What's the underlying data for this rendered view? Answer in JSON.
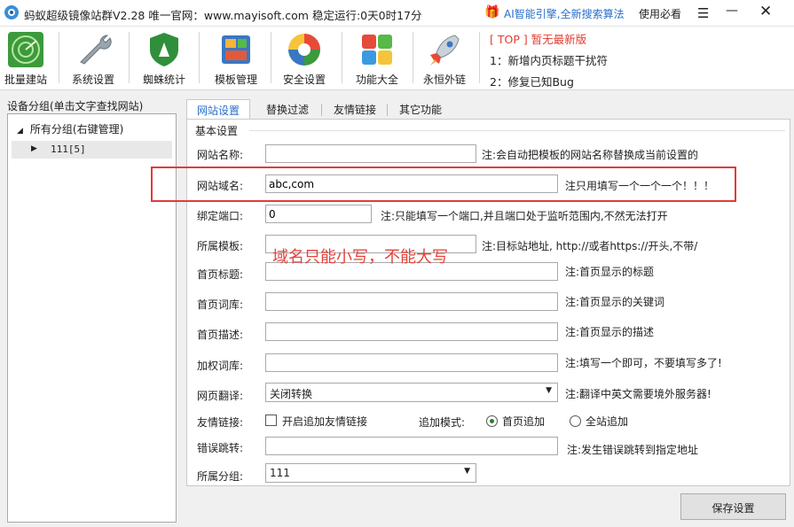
{
  "window": {
    "title": "蚂蚁超级镜像站群V2.28  唯一官网：www.mayisoft.com  稳定运行:0天0时17分",
    "ai_link": "AI智能引擎,全新搜索算法",
    "help": "使用必看",
    "minimize": "—",
    "close": "✕"
  },
  "toolbar": {
    "items": [
      {
        "label": "批量建站",
        "icon": "radar-icon"
      },
      {
        "label": "系统设置",
        "icon": "wrench-icon"
      },
      {
        "label": "蜘蛛统计",
        "icon": "spider-shield-icon"
      },
      {
        "label": "模板管理",
        "icon": "template-icon"
      },
      {
        "label": "安全设置",
        "icon": "security-icon"
      },
      {
        "label": "功能大全",
        "icon": "tiles-icon"
      },
      {
        "label": "永恒外链",
        "icon": "rocket-icon"
      }
    ],
    "news_title": "[ TOP ] 暂无最新版",
    "news_lines": [
      "1：新增内页标题干扰符",
      "2：修复已知Bug"
    ]
  },
  "left": {
    "label": "设备分组(单击文字查找网站)",
    "root": "所有分组(右键管理)",
    "child": "111[5]"
  },
  "tabs": [
    "网站设置",
    "替换过滤",
    "友情链接",
    "其它功能"
  ],
  "form": {
    "group": "基本设置",
    "site_name": {
      "label": "网站名称:",
      "value": "",
      "note": "注:会自动把模板的网站名称替换成当前设置的"
    },
    "domain": {
      "label": "网站域名:",
      "value": "abc,com",
      "note": "注只用填写一个一个一个！！！"
    },
    "port": {
      "label": "绑定端口:",
      "value": "0",
      "note": "注:只能填写一个端口,并且端口处于监听范围内,不然无法打开"
    },
    "template": {
      "label": "所属模板:",
      "value": "",
      "note": "注:目标站地址, http://或者https://开头,不带/"
    },
    "home_title": {
      "label": "首页标题:",
      "value": "",
      "note": "注:首页显示的标题"
    },
    "home_keywords": {
      "label": "首页词库:",
      "value": "",
      "note": "注:首页显示的关键词"
    },
    "home_desc": {
      "label": "首页描述:",
      "value": "",
      "note": "注:首页显示的描述"
    },
    "weight_words": {
      "label": "加权词库:",
      "value": "",
      "note": "注:填写一个即可，不要填写多了!"
    },
    "translate": {
      "label": "网页翻译:",
      "value": "关闭转换",
      "note": "注:翻译中英文需要境外服务器!"
    },
    "friend_link": {
      "label": "友情链接:",
      "checkbox": "开启追加友情链接",
      "mode_label": "追加模式:",
      "radio1": "首页追加",
      "radio2": "全站追加"
    },
    "error_redirect": {
      "label": "错误跳转:",
      "value": "",
      "note": "注:发生错误跳转到指定地址"
    },
    "group_select": {
      "label": "所属分组:",
      "value": "111"
    }
  },
  "annotation": "域名只能小写，不能大写",
  "save_button": "保存设置"
}
